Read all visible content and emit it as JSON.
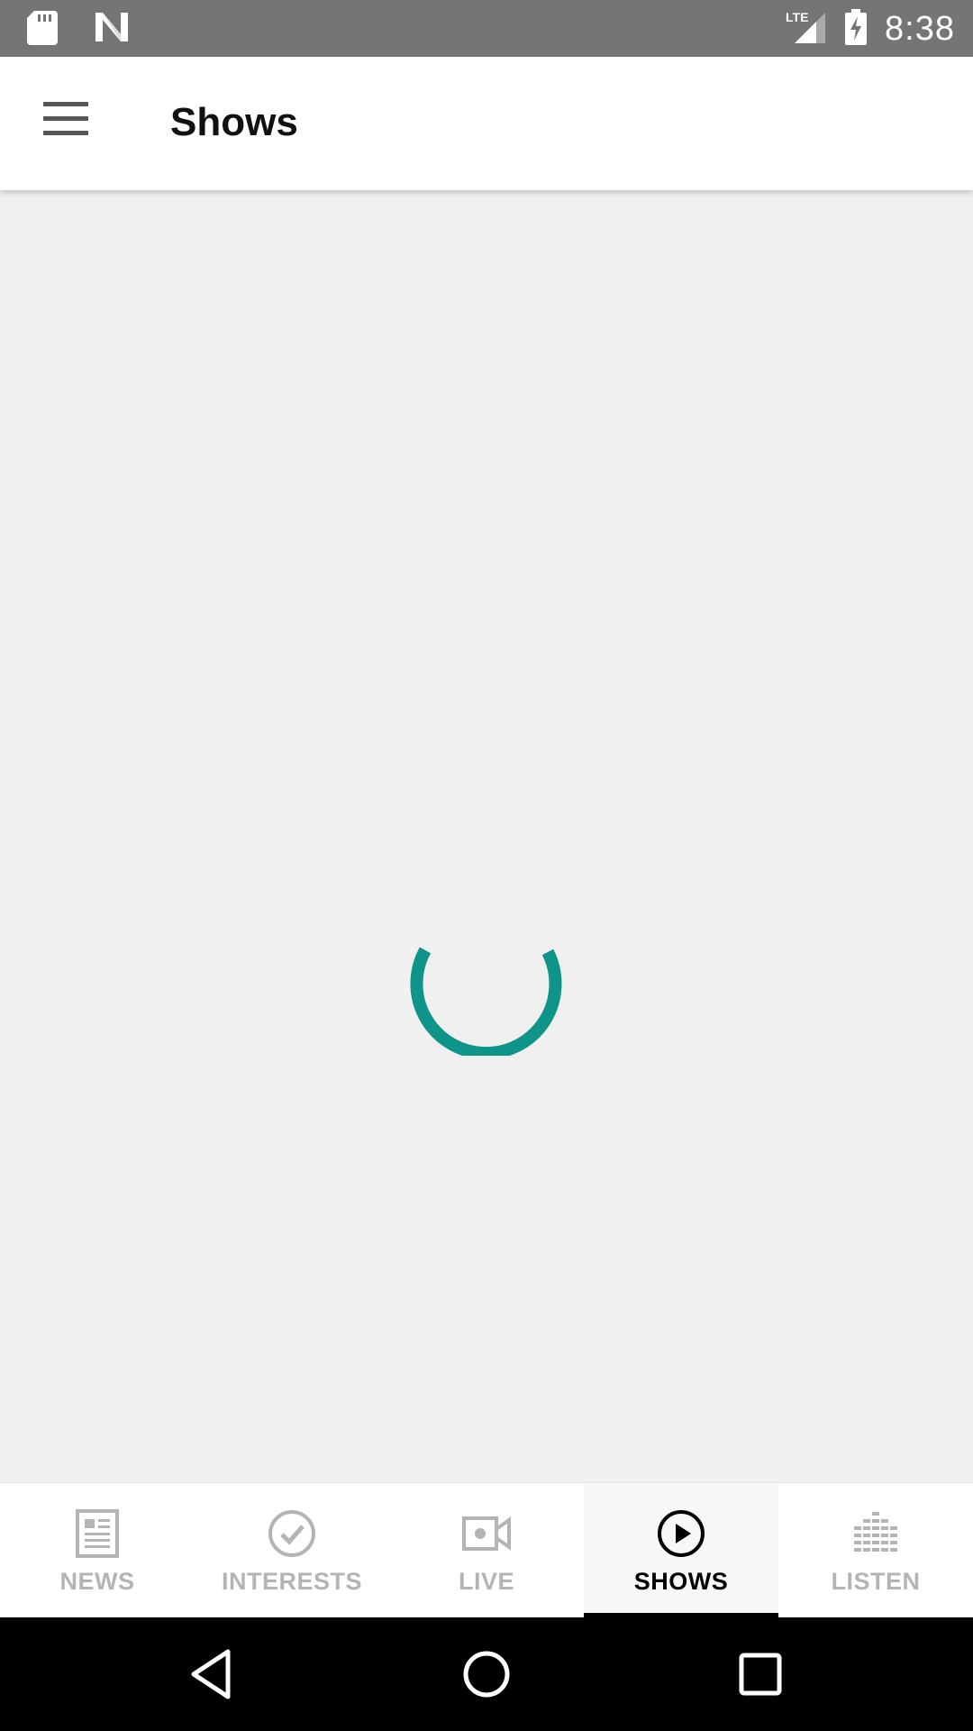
{
  "status_bar": {
    "time": "8:38",
    "icons": [
      "sd-card-icon",
      "n-notification-icon",
      "lte-signal-icon",
      "battery-charging-icon"
    ],
    "network": "LTE"
  },
  "app_bar": {
    "title": "Shows",
    "menu_icon": "hamburger-menu-icon"
  },
  "content": {
    "loading": true,
    "spinner_color": "#0e9488"
  },
  "bottom_nav": {
    "items": [
      {
        "label": "NEWS",
        "icon": "newspaper-icon",
        "active": false
      },
      {
        "label": "INTERESTS",
        "icon": "check-circle-icon",
        "active": false
      },
      {
        "label": "LIVE",
        "icon": "video-camera-icon",
        "active": false
      },
      {
        "label": "SHOWS",
        "icon": "play-circle-icon",
        "active": true
      },
      {
        "label": "LISTEN",
        "icon": "equalizer-icon",
        "active": false
      }
    ]
  },
  "system_nav": {
    "buttons": [
      "back-icon",
      "home-icon",
      "recents-icon"
    ]
  },
  "colors": {
    "accent": "#0e9488",
    "inactive": "#b4b4b4",
    "active": "#000000",
    "status_bar": "#757575"
  }
}
